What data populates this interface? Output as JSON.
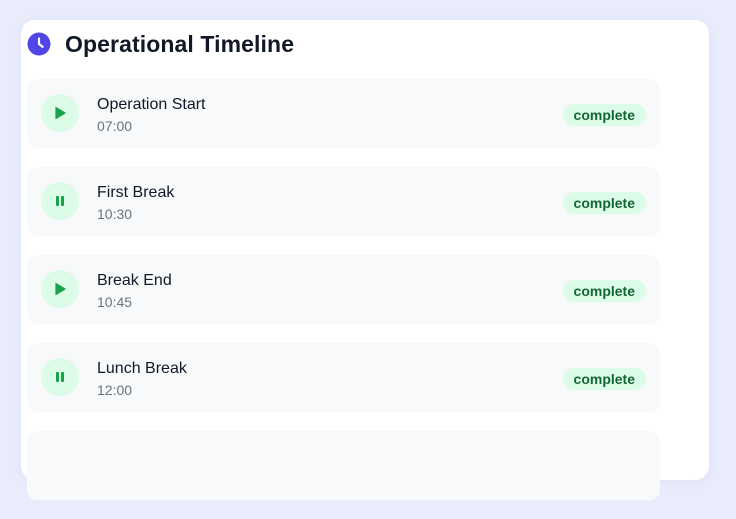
{
  "header": {
    "title": "Operational Timeline",
    "icon": "clock-icon"
  },
  "colors": {
    "accent": "#4f46e5",
    "badge_bg": "#dcfce7",
    "badge_text": "#166534",
    "icon_green": "#16a34a"
  },
  "events": [
    {
      "title": "Operation Start",
      "time": "07:00",
      "status": "complete",
      "icon": "play-icon"
    },
    {
      "title": "First Break",
      "time": "10:30",
      "status": "complete",
      "icon": "pause-icon"
    },
    {
      "title": "Break End",
      "time": "10:45",
      "status": "complete",
      "icon": "play-icon"
    },
    {
      "title": "Lunch Break",
      "time": "12:00",
      "status": "complete",
      "icon": "pause-icon"
    }
  ]
}
